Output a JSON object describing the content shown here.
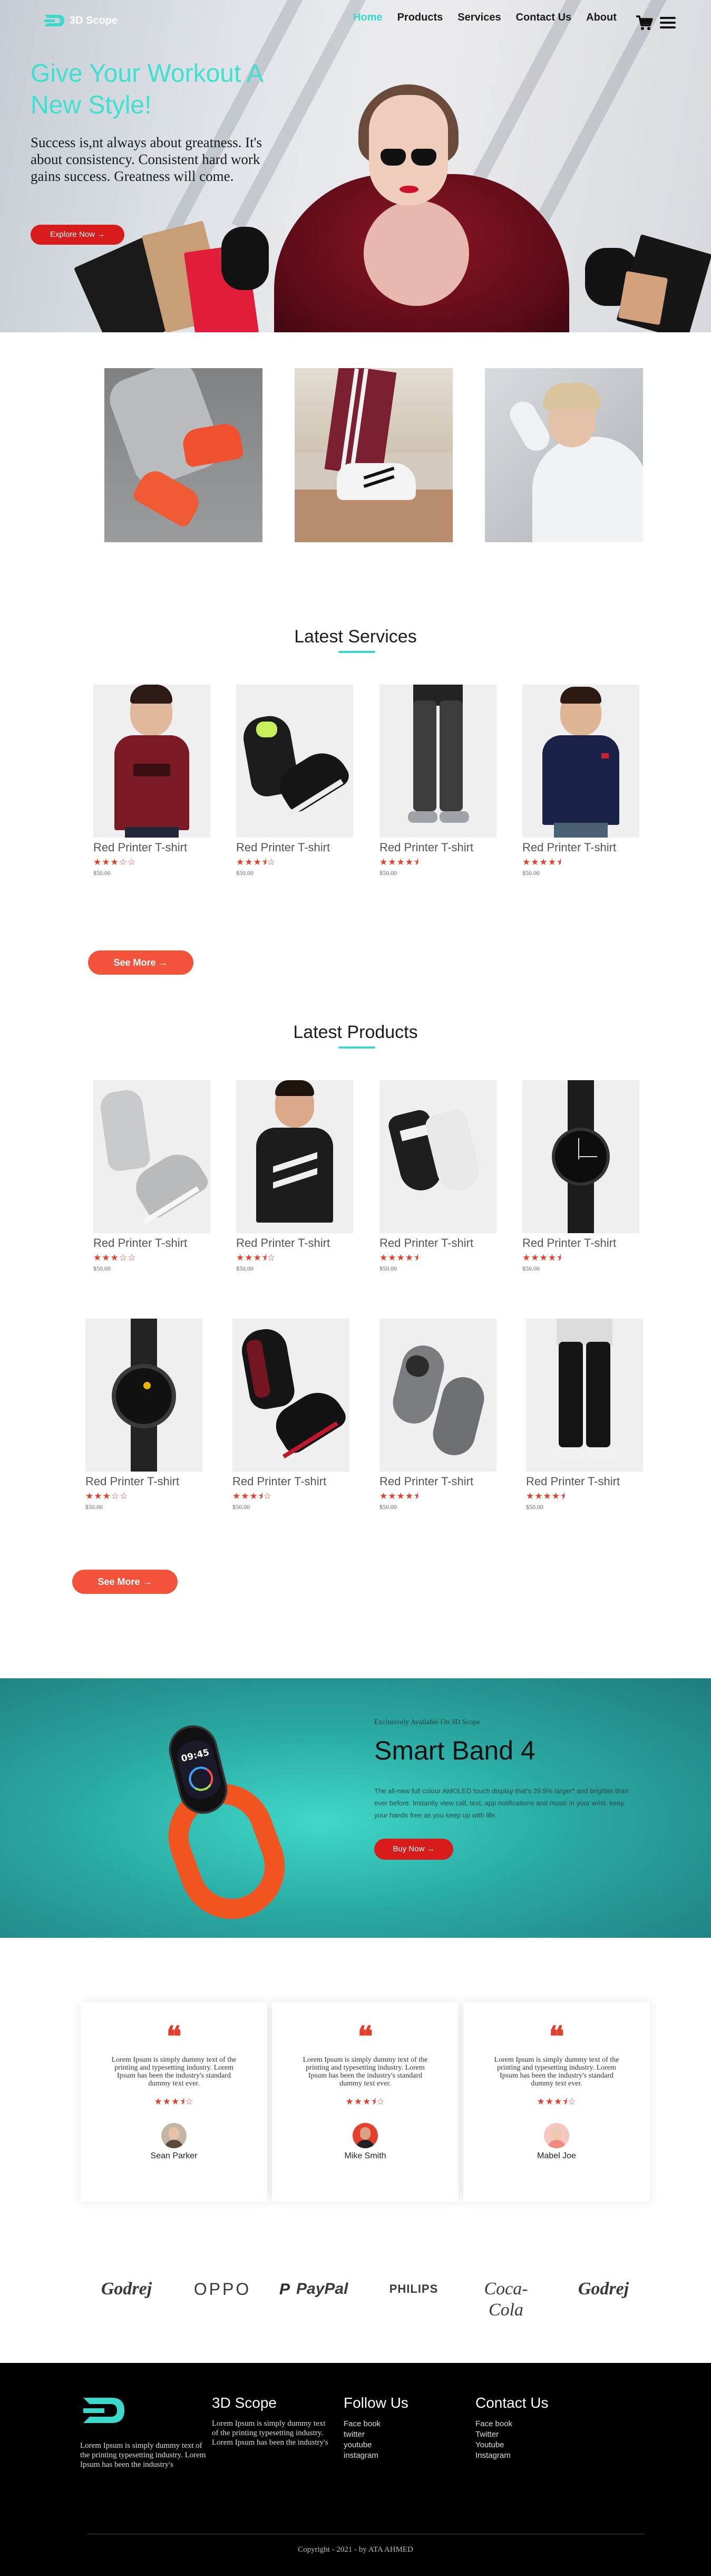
{
  "brand": {
    "name": "3D Scope",
    "accent": "#3cd8cc",
    "primary_red": "#d81b1b",
    "coral": "#f2533a"
  },
  "nav": {
    "links": [
      "Home",
      "Products",
      "Services",
      "Contact Us",
      "About"
    ],
    "active": "Home"
  },
  "hero": {
    "title": "Give Your Workout A New Style!",
    "text": "Success is,nt always about greatness. It's about consistency. Consistent hard work gains success. Greatness will come.",
    "button": "Explore Now →"
  },
  "services": {
    "title": "Latest Services",
    "items": [
      {
        "name": "Red Printer T-shirt",
        "stars": "★★★☆☆",
        "rating": 3,
        "price": "$50.00",
        "image": "maroon-tshirt"
      },
      {
        "name": "Red Printer T-shirt",
        "stars": "★★★⯨☆",
        "rating": 3.5,
        "price": "$50.00",
        "image": "black-sneakers"
      },
      {
        "name": "Red Printer T-shirt",
        "stars": "★★★★⯨",
        "rating": 4.5,
        "price": "$50.00",
        "image": "grey-joggers"
      },
      {
        "name": "Red Printer T-shirt",
        "stars": "★★★★⯨",
        "rating": 4.5,
        "price": "$50.00",
        "image": "navy-polo"
      }
    ],
    "see_more": "See More →"
  },
  "products": {
    "title": "Latest Products",
    "row1": [
      {
        "name": "Red Printer T-shirt",
        "stars": "★★★☆☆",
        "rating": 3,
        "price": "$50.00",
        "image": "grey-hightops"
      },
      {
        "name": "Red Printer T-shirt",
        "stars": "★★★⯨☆",
        "rating": 3.5,
        "price": "$50.00",
        "image": "black-tshirt"
      },
      {
        "name": "Red Printer T-shirt",
        "stars": "★★★★⯨",
        "rating": 4.5,
        "price": "$50.00",
        "image": "socks"
      },
      {
        "name": "Red Printer T-shirt",
        "stars": "★★★★⯨",
        "rating": 4.5,
        "price": "$50.00",
        "image": "black-watch"
      }
    ],
    "row2": [
      {
        "name": "Red Printer T-shirt",
        "stars": "★★★☆☆",
        "rating": 3,
        "price": "$50.00",
        "image": "smart-watch"
      },
      {
        "name": "Red Printer T-shirt",
        "stars": "★★★⯨☆",
        "rating": 3.5,
        "price": "$50.00",
        "image": "black-red-shoes"
      },
      {
        "name": "Red Printer T-shirt",
        "stars": "★★★★⯨",
        "rating": 4.5,
        "price": "$50.00",
        "image": "grey-slipons"
      },
      {
        "name": "Red Printer T-shirt",
        "stars": "★★★★⯨",
        "rating": 4.5,
        "price": "$50.00",
        "image": "black-trackpants"
      }
    ],
    "see_more": "See More →"
  },
  "offer": {
    "small": "Exclusively Available On 3D Scope",
    "title": "Smart Band 4",
    "desc": "The all-new full colour AMOLED touch display that's 39.9% larger* and brighter than ever before. Instantly view call, text, app notifications and music in your wrist. keep your hands free as you keep up with life.",
    "button": "Buy Now →",
    "band_time": "09:45"
  },
  "testimonials": [
    {
      "text": "Lorem Ipsum is simply dummy text of the printing and typesetting industry. Lorem Ipsum has been the industry's standard dummy text ever.",
      "stars": "★★★⯨☆",
      "rating": 3.5,
      "name": "Sean Parker"
    },
    {
      "text": "Lorem Ipsum is simply dummy text of the printing and typesetting industry. Lorem Ipsum has been the industry's standard dummy text ever.",
      "stars": "★★★⯨☆",
      "rating": 3.5,
      "name": "Mike Smith"
    },
    {
      "text": "Lorem Ipsum is simply dummy text of the printing and typesetting industry. Lorem Ipsum has been the industry's standard dummy text ever.",
      "stars": "★★★⯨☆",
      "rating": 3.5,
      "name": "Mabel Joe"
    }
  ],
  "brands": [
    "Godrej",
    "OPPO",
    "PayPal",
    "PHILIPS",
    "Coca-Cola",
    "Godrej"
  ],
  "footer": {
    "about": "Lorem Ipsum is simply dummy text of the printing typesetting industry. Lorem Ipsum has been the industry's",
    "col2_title": "3D Scope",
    "col2_text": "Lorem Ipsum is simply dummy text of the printing typesetting industry. Lorem Ipsum has been the industry's",
    "col3_title": "Follow Us",
    "col3_links": [
      "Face book",
      "twitter",
      "youtube",
      "instagram"
    ],
    "col4_title": "Contact Us",
    "col4_links": [
      "Face book",
      "Twitter",
      "Youtube",
      "Instagram"
    ],
    "copyright": "Copyright - 2021 - by ATA AHMED"
  }
}
